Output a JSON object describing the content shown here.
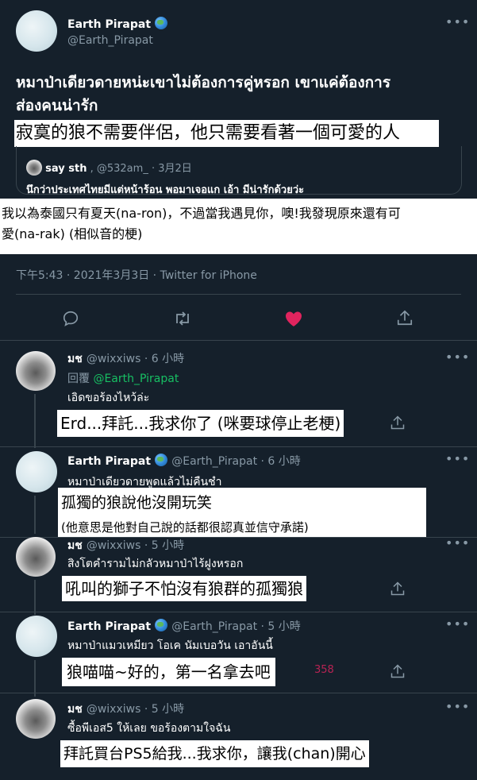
{
  "main_tweet": {
    "author_name": "Earth Pirapat",
    "author_handle": "@Earth_Pirapat",
    "text_line1": "หมาป่าเดียวดายหน่ะเขาไม่ต้องการคู่หรอก เขาแค่ต้องการ",
    "text_line2": "ส่องคนน่ารัก",
    "translation": "寂寞的狼不需要伴侶，他只需要看著一個可愛的人",
    "quoted": {
      "author_name": "say sth",
      "author_handle": ", @532am_",
      "date": "· 3月2日",
      "text": "นึกว่าประเทศไทยมีแต่หน้าร้อน พอมาเจอแก เอ้า มีน่ารักด้วยว่ะ"
    },
    "quote_translation_line1": "我以為泰國只有夏天(na-ron)，不過當我遇見你，噢!我發現原來還有可",
    "quote_translation_line2": "愛(na-rak)  (相似音的梗)",
    "timestamp": "下午5:43 · 2021年3月3日 · Twitter for iPhone"
  },
  "actions": {
    "reply_icon": "reply-icon",
    "retweet_icon": "retweet-icon",
    "like_icon": "heart-icon-filled",
    "share_icon": "share-icon",
    "like_color": "#e0245e"
  },
  "replies": [
    {
      "author_name": "มช",
      "author_handle": "@wixxiws · 6 小時",
      "reply_to_label": "回覆",
      "reply_to_handle": "@Earth_Pirapat",
      "text": "เอิดขอร้องไหว้ล่ะ",
      "translation": "Erd...拜託...我求你了 (咪要球停止老梗)"
    },
    {
      "author_name": "Earth Pirapat",
      "author_handle": "@Earth_Pirapat · 6 小時",
      "text": "หมาป่าเดียวดายพูดแล้วไม่คืนชำ",
      "translation": "孤獨的狼說他沒開玩笑",
      "note": "(他意思是他對自己說的話都很認真並信守承諾)"
    },
    {
      "author_name": "มช",
      "author_handle": "@wixxiws · 5 小時",
      "text": "สิงโตคำรามไม่กลัวหมาป่าไร้ฝูงหรอก",
      "translation": "吼叫的獅子不怕沒有狼群的孤獨狼"
    },
    {
      "author_name": "Earth Pirapat",
      "author_handle": "@Earth_Pirapat · 5 小時",
      "text": "หมาป่าแมวเหมียว โอเค นัมเบอวัน เอาอันนี้",
      "translation": "狼喵喵~好的，第一名拿去吧",
      "watermark": "358"
    },
    {
      "author_name": "มช",
      "author_handle": "@wixxiws · 5 小時",
      "text": "ซื้อพีเอส5 ให้เลย ขอร้องตามใจฉัน",
      "translation": "拜託買台PS5給我...我求你，讓我(chan)開心"
    }
  ]
}
